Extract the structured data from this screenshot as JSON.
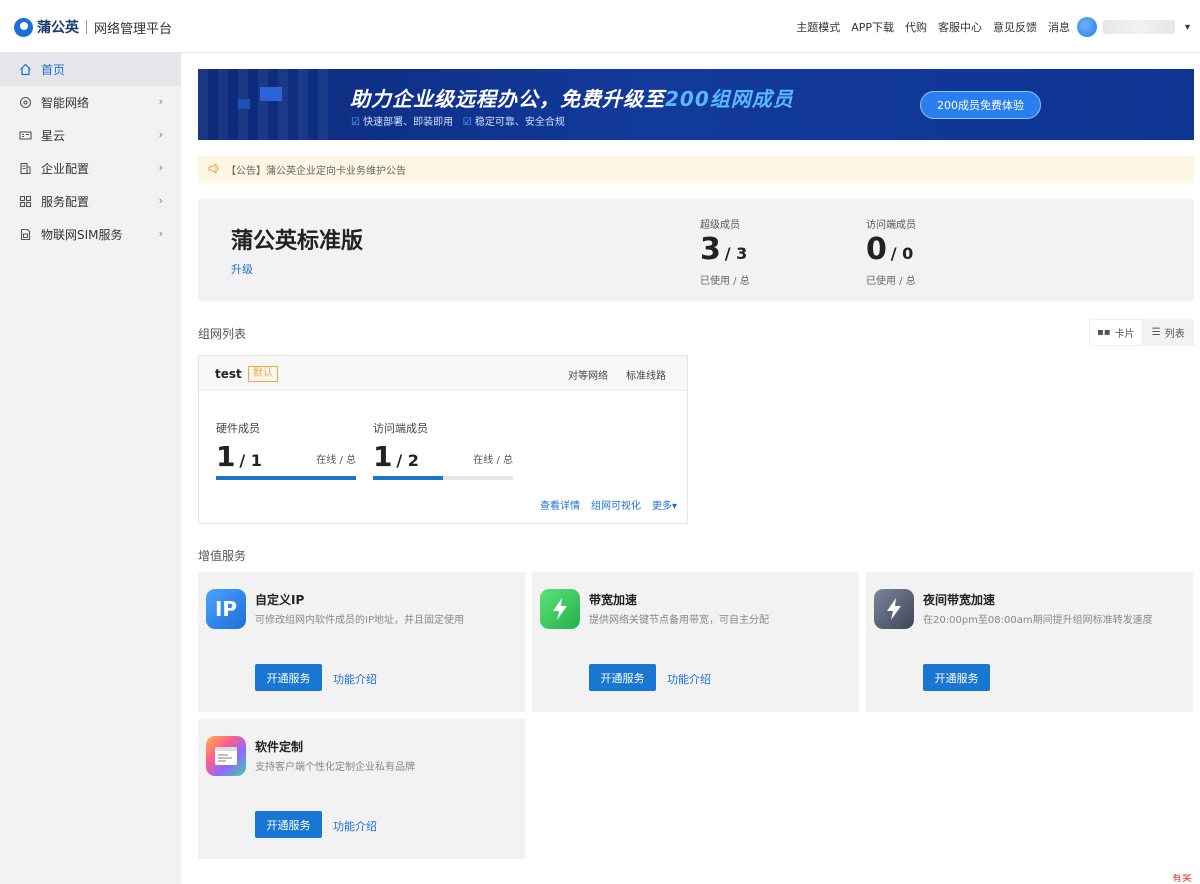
{
  "header": {
    "logo_name": "蒲公英",
    "logo_subtitle": "网络管理平台",
    "nav": [
      "主题模式",
      "APP下载",
      "代购",
      "客服中心",
      "意见反馈",
      "消息"
    ],
    "caret": "▾"
  },
  "sidebar": {
    "items": [
      {
        "label": "首页",
        "icon": "home-icon",
        "active": true
      },
      {
        "label": "智能网络",
        "icon": "network-icon"
      },
      {
        "label": "星云",
        "icon": "cloud-device-icon"
      },
      {
        "label": "企业配置",
        "icon": "building-icon"
      },
      {
        "label": "服务配置",
        "icon": "grid-icon"
      },
      {
        "label": "物联网SIM服务",
        "icon": "sim-icon"
      }
    ]
  },
  "banner": {
    "title_main": "助力企业级远程办公，免费升级至",
    "title_highlight": "200组网成员",
    "features": [
      "快速部署、即装即用",
      "稳定可靠、安全合规"
    ],
    "button": "200成员免费体验"
  },
  "notice": {
    "text": "【公告】蒲公英企业定向卡业务维护公告"
  },
  "plan": {
    "name": "蒲公英标准版",
    "upgrade": "升级",
    "stats": [
      {
        "label": "超级成员",
        "used": "3",
        "total": "/ 3",
        "foot": "已使用 / 总"
      },
      {
        "label": "访问端成员",
        "used": "0",
        "total": "/ 0",
        "foot": "已使用 / 总"
      }
    ]
  },
  "network_list": {
    "title": "组网列表",
    "view_card": "卡片",
    "view_list": "列表",
    "card": {
      "name": "test",
      "badge": "默认",
      "tags": [
        "对等网络",
        "标准线路"
      ],
      "members": [
        {
          "label": "硬件成员",
          "online": "1",
          "total": "/ 1",
          "unit": "在线 / 总",
          "fraction": 1.0
        },
        {
          "label": "访问端成员",
          "online": "1",
          "total": "/ 2",
          "unit": "在线 / 总",
          "fraction": 0.5
        }
      ],
      "links": [
        "查看详情",
        "组网可视化",
        "更多▾"
      ]
    }
  },
  "value_services": {
    "title": "增值服务",
    "items": [
      {
        "title": "自定义IP",
        "desc": "可修改组网内软件成员的IP地址，并且固定使用",
        "button": "开通服务",
        "link": "功能介绍",
        "icon": "ip-icon",
        "icon_text": "IP",
        "color": "#2f8df0"
      },
      {
        "title": "带宽加速",
        "desc": "提供网络关键节点备用带宽，可自主分配",
        "button": "开通服务",
        "link": "功能介绍",
        "icon": "lightning-icon",
        "color": "#2ec455"
      },
      {
        "title": "夜间带宽加速",
        "desc": "在20:00pm至08:00am期间提升组网标准转发速度",
        "button": "开通服务",
        "link": "",
        "icon": "night-lightning-icon",
        "color": "#4a5568"
      },
      {
        "title": "软件定制",
        "desc": "支持客户端个性化定制企业私有品牌",
        "button": "开通服务",
        "link": "功能介绍",
        "icon": "window-icon",
        "color": "#e94f86"
      }
    ]
  },
  "corner_text": "有奖"
}
